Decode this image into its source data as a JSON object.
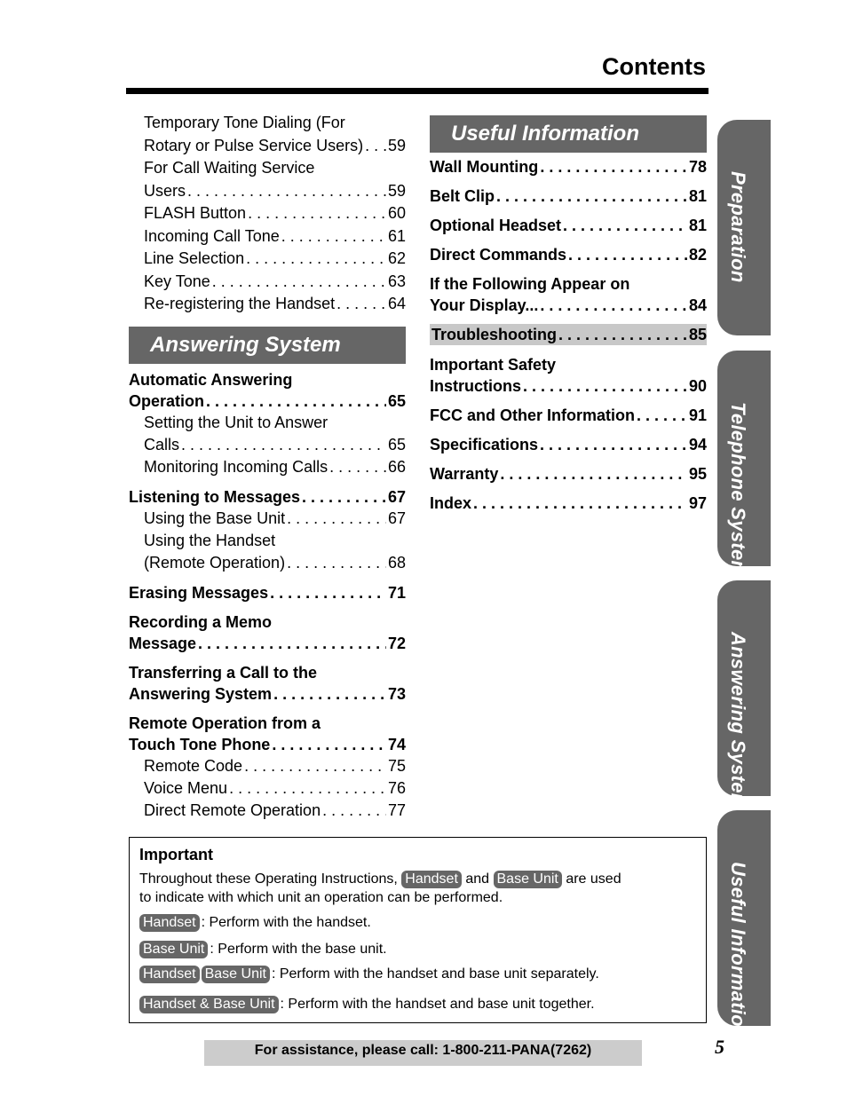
{
  "header": {
    "title": "Contents"
  },
  "left_column": {
    "continued_entries": [
      {
        "lines": [
          "Temporary Tone Dialing (For",
          "Rotary or Pulse Service Users)"
        ],
        "page": "59"
      },
      {
        "lines": [
          "For Call Waiting Service",
          "Users"
        ],
        "page": "59"
      },
      {
        "lines": [
          "FLASH Button"
        ],
        "page": "60"
      },
      {
        "lines": [
          "Incoming Call Tone"
        ],
        "page": "61"
      },
      {
        "lines": [
          "Line Selection"
        ],
        "page": "62"
      },
      {
        "lines": [
          "Key Tone"
        ],
        "page": "63"
      },
      {
        "lines": [
          "Re-registering the Handset"
        ],
        "page": "64"
      }
    ],
    "section_title": "Answering System",
    "entries": [
      {
        "lines": [
          "Automatic Answering",
          "Operation"
        ],
        "page": "65",
        "level": "main"
      },
      {
        "lines": [
          "Setting the Unit to Answer",
          "Calls"
        ],
        "page": "65",
        "level": "sub"
      },
      {
        "lines": [
          "Monitoring Incoming Calls"
        ],
        "page": "66",
        "level": "sub"
      },
      {
        "lines": [
          "Listening to Messages"
        ],
        "page": "67",
        "level": "main"
      },
      {
        "lines": [
          "Using the Base Unit"
        ],
        "page": "67",
        "level": "sub"
      },
      {
        "lines": [
          "Using the Handset",
          "(Remote Operation)"
        ],
        "page": "68",
        "level": "sub"
      },
      {
        "lines": [
          "Erasing Messages"
        ],
        "page": "71",
        "level": "main"
      },
      {
        "lines": [
          "Recording a Memo",
          "Message"
        ],
        "page": "72",
        "level": "main"
      },
      {
        "lines": [
          "Transferring a Call to the",
          "Answering System"
        ],
        "page": "73",
        "level": "main"
      },
      {
        "lines": [
          "Remote Operation from a",
          "Touch Tone Phone"
        ],
        "page": "74",
        "level": "main"
      },
      {
        "lines": [
          "Remote Code"
        ],
        "page": "75",
        "level": "sub"
      },
      {
        "lines": [
          "Voice Menu"
        ],
        "page": "76",
        "level": "sub"
      },
      {
        "lines": [
          "Direct Remote Operation"
        ],
        "page": "77",
        "level": "sub"
      }
    ]
  },
  "right_column": {
    "section_title": "Useful Information",
    "entries": [
      {
        "lines": [
          "Wall Mounting"
        ],
        "page": "78"
      },
      {
        "lines": [
          "Belt Clip"
        ],
        "page": "81"
      },
      {
        "lines": [
          "Optional Headset"
        ],
        "page": "81"
      },
      {
        "lines": [
          "Direct Commands"
        ],
        "page": "82"
      },
      {
        "lines": [
          "If the Following Appear on",
          "Your Display..."
        ],
        "page": "84"
      },
      {
        "lines": [
          "Troubleshooting"
        ],
        "page": "85",
        "highlighted": true
      },
      {
        "lines": [
          "Important Safety",
          "Instructions"
        ],
        "page": "90"
      },
      {
        "lines": [
          "FCC and Other Information"
        ],
        "page": "91"
      },
      {
        "lines": [
          "Specifications"
        ],
        "page": "94"
      },
      {
        "lines": [
          "Warranty"
        ],
        "page": "95"
      },
      {
        "lines": [
          "Index"
        ],
        "page": "97"
      }
    ]
  },
  "tabs": [
    {
      "label": "Preparation"
    },
    {
      "label": "Telephone System"
    },
    {
      "label": "Answering System"
    },
    {
      "label": "Useful Information"
    }
  ],
  "important": {
    "title": "Important",
    "intro_pre": "Throughout these Operating Instructions,",
    "intro_chip1": "Handset",
    "intro_mid": "and",
    "intro_chip2": "Base Unit",
    "intro_post": "are used",
    "intro_line2": "to indicate with which unit an operation can be performed.",
    "legend": [
      {
        "chips": [
          "Handset"
        ],
        "text": ": Perform with the handset."
      },
      {
        "chips": [
          "Base Unit"
        ],
        "text": ": Perform with the base unit."
      },
      {
        "chips": [
          "Handset",
          "Base Unit"
        ],
        "text": ": Perform with the handset and base unit separately."
      },
      {
        "chips": [
          "Handset & Base Unit"
        ],
        "text": ": Perform with the handset and base unit together."
      }
    ]
  },
  "footer": {
    "assistance": "For assistance, please call: 1-800-211-PANA(7262)",
    "page_number": "5"
  },
  "colors": {
    "header_gray": "#666666",
    "highlight_gray": "#c8c8c8",
    "footer_gray": "#cccccc"
  }
}
